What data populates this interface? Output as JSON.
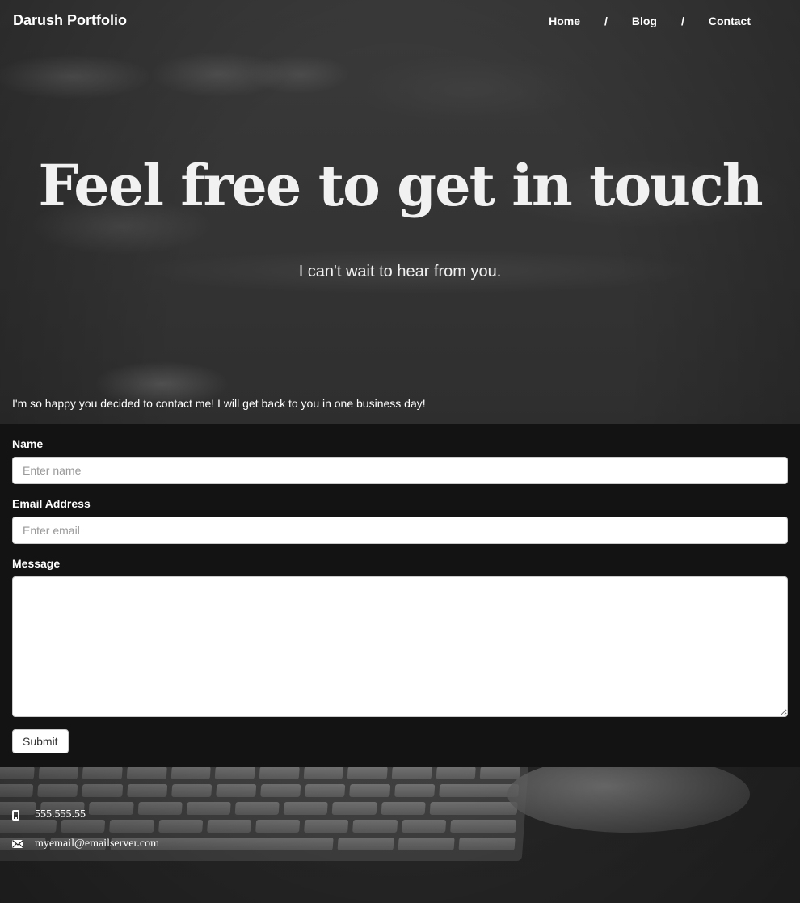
{
  "brand": "Darush Portfolio",
  "nav": {
    "items": [
      "Home",
      "Blog",
      "Contact"
    ],
    "separator": "/"
  },
  "hero": {
    "title": "Feel free to get in touch",
    "subtitle": "I can't wait to hear from you."
  },
  "intro": "I'm so happy you decided to contact me! I will get back to you in one business day!",
  "form": {
    "name_label": "Name",
    "name_placeholder": "Enter name",
    "email_label": "Email Address",
    "email_placeholder": "Enter email",
    "message_label": "Message",
    "submit_label": "Submit"
  },
  "contact": {
    "phone": "555.555.55",
    "phone_icon": "phone-icon",
    "email": "myemail@emailserver.com",
    "email_icon": "envelope-icon"
  }
}
